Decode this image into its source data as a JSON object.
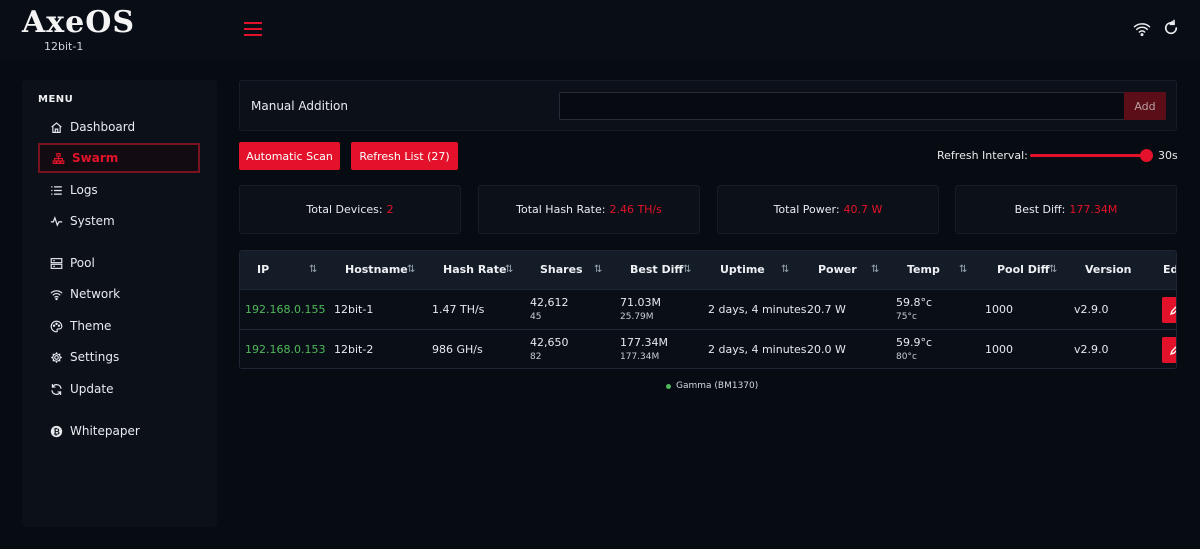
{
  "header": {
    "logo": "AxeOS",
    "subtitle": "12bit-1"
  },
  "sidebar": {
    "title": "MENU",
    "items": [
      {
        "label": "Dashboard",
        "icon": "home-icon"
      },
      {
        "label": "Swarm",
        "icon": "sitemap-icon",
        "active": true
      },
      {
        "label": "Logs",
        "icon": "list-icon"
      },
      {
        "label": "System",
        "icon": "pulse-icon"
      },
      {
        "label": "Pool",
        "icon": "server-icon"
      },
      {
        "label": "Network",
        "icon": "wifi-icon"
      },
      {
        "label": "Theme",
        "icon": "palette-icon"
      },
      {
        "label": "Settings",
        "icon": "gear-icon"
      },
      {
        "label": "Update",
        "icon": "refresh-icon"
      },
      {
        "label": "Whitepaper",
        "icon": "bitcoin-icon"
      }
    ]
  },
  "manual": {
    "label": "Manual Addition",
    "input_value": "",
    "add_label": "Add"
  },
  "actions": {
    "scan_label": "Automatic Scan",
    "refresh_label": "Refresh List (27)",
    "interval_label": "Refresh Interval:",
    "interval_value": "30s",
    "interval_fraction": 0.95
  },
  "stats": [
    {
      "label": "Total Devices:",
      "value": "2"
    },
    {
      "label": "Total Hash Rate:",
      "value": "2.46 TH/s"
    },
    {
      "label": "Total Power:",
      "value": "40.7 W"
    },
    {
      "label": "Best Diff:",
      "value": "177.34M"
    }
  ],
  "table": {
    "columns": [
      "IP",
      "Hostname",
      "Hash Rate",
      "Shares",
      "Best Diff",
      "Uptime",
      "Power",
      "Temp",
      "Pool Diff",
      "Version",
      "Edit"
    ],
    "sort_glyphs": {
      "IP": "⇅",
      "Hostname": "⇅",
      "Hash Rate": "⇅",
      "Shares": "⇅",
      "Best Diff": "⇅",
      "Uptime": "⇅",
      "Power": "⇅",
      "Temp": "⇅",
      "Pool Diff": "⇅"
    },
    "rows": [
      {
        "ip": "192.168.0.155",
        "hostname": "12bit-1",
        "hashrate": "1.47 TH/s",
        "shares": "42,612",
        "shares_sub": "45",
        "bestdiff": "71.03M",
        "bestdiff_sub": "25.79M",
        "uptime": "2 days, 4 minutes",
        "power": "20.7 W",
        "temp": "59.8°c",
        "temp_sub": "75°c",
        "pooldiff": "1000",
        "version": "v2.9.0"
      },
      {
        "ip": "192.168.0.153",
        "hostname": "12bit-2",
        "hashrate": "986 GH/s",
        "shares": "42,650",
        "shares_sub": "82",
        "bestdiff": "177.34M",
        "bestdiff_sub": "177.34M",
        "uptime": "2 days, 4 minutes",
        "power": "20.0 W",
        "temp": "59.9°c",
        "temp_sub": "80°c",
        "pooldiff": "1000",
        "version": "v2.9.0"
      }
    ]
  },
  "legend": {
    "label": "Gamma (BM1370)"
  },
  "colors": {
    "accent": "#e3122a",
    "ip": "#4fb85a",
    "background": "#070b12"
  }
}
